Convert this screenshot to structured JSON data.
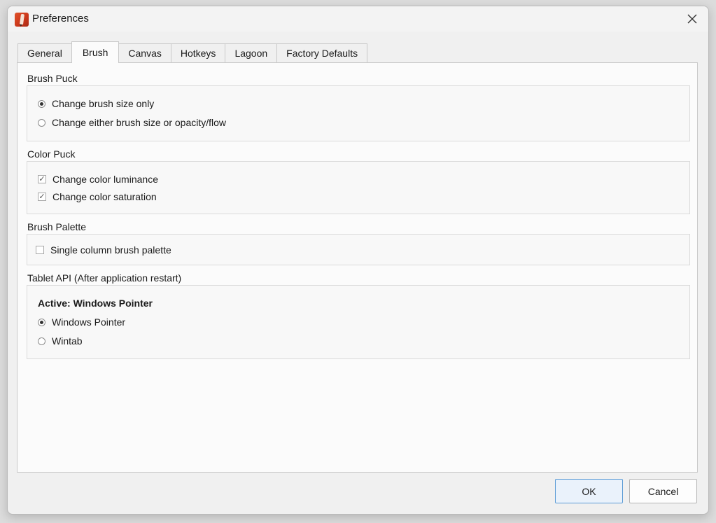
{
  "window": {
    "title": "Preferences"
  },
  "tabs": [
    {
      "label": "General",
      "active": false
    },
    {
      "label": "Brush",
      "active": true
    },
    {
      "label": "Canvas",
      "active": false
    },
    {
      "label": "Hotkeys",
      "active": false
    },
    {
      "label": "Lagoon",
      "active": false
    },
    {
      "label": "Factory Defaults",
      "active": false
    }
  ],
  "brush_puck": {
    "label": "Brush Puck",
    "options": [
      {
        "label": "Change brush size only",
        "selected": true
      },
      {
        "label": "Change either brush size or opacity/flow",
        "selected": false
      }
    ]
  },
  "color_puck": {
    "label": "Color Puck",
    "options": [
      {
        "label": "Change color luminance",
        "checked": true
      },
      {
        "label": "Change color saturation",
        "checked": true
      }
    ]
  },
  "brush_palette": {
    "label": "Brush Palette",
    "options": [
      {
        "label": "Single column brush palette",
        "checked": false
      }
    ]
  },
  "tablet_api": {
    "label": "Tablet API (After application restart)",
    "active_text": "Active: Windows Pointer",
    "options": [
      {
        "label": "Windows Pointer",
        "selected": true
      },
      {
        "label": "Wintab",
        "selected": false
      }
    ]
  },
  "buttons": {
    "ok": "OK",
    "cancel": "Cancel"
  },
  "icons": {
    "app": "sketchbook-app-icon",
    "close": "close-icon",
    "check_glyph": "✓"
  },
  "colors": {
    "accent": "#5b9bd5",
    "panel": "#fbfbfb"
  }
}
